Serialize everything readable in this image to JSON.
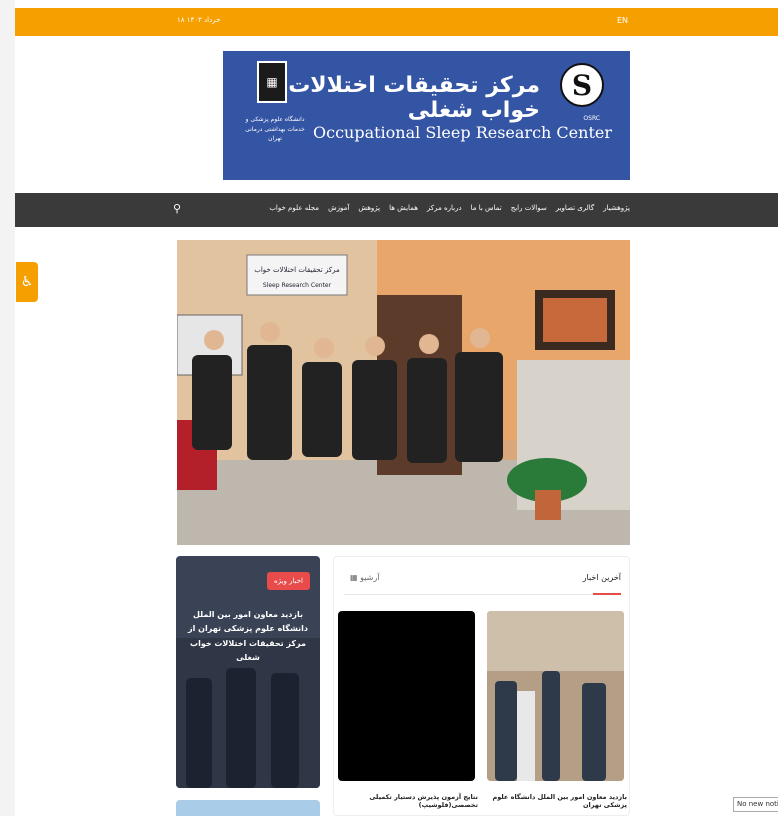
{
  "topbar": {
    "date": "۱۸ خرداد ۱۴۰۳",
    "lang": "EN"
  },
  "banner": {
    "title_fa": "مرکز تحقیقات اختلالات خواب شغلی",
    "title_en": "Occupational Sleep Research Center",
    "university": "دانشگاه علوم پزشکی و خدمات بهداشتی درمانی تهران",
    "logo_text": "S",
    "logo_caption": "OSRC"
  },
  "nav": {
    "items": [
      "مجله علوم خواب",
      "آموزش",
      "پژوهش",
      "همایش ها",
      "درباره مرکز",
      "تماس با ما",
      "سوالات رایج",
      "گالری تصاویر",
      "پژوهشیار"
    ],
    "search_icon": "search-icon"
  },
  "slider": {
    "sign_fa": "مرکز تحقیقات اختلالات خواب",
    "sign_en": "Sleep Research Center",
    "dots": 4,
    "active_dot": 3
  },
  "special": {
    "badge": "اخبار ویژه",
    "title": "بازدید معاون امور بین الملل دانشگاه علوم پزشکی تهران از مرکز تحقیقات اختلالات خواب شغلی"
  },
  "news": {
    "heading": "آخرین اخبار",
    "archive": "آرشیو",
    "items": [
      {
        "caption": "بازدید معاون امور بین الملل دانشگاه علوم پزشکی تهران"
      },
      {
        "caption": "نتایج آزمون پذیرش دستیار تکمیلی تخصصی(فلوشیپ)"
      }
    ]
  },
  "notification": "No new notifications",
  "colors": {
    "accent": "#f5a000",
    "banner": "#3454a4",
    "nav": "#3a3a3a",
    "badge": "#e94b4b"
  }
}
